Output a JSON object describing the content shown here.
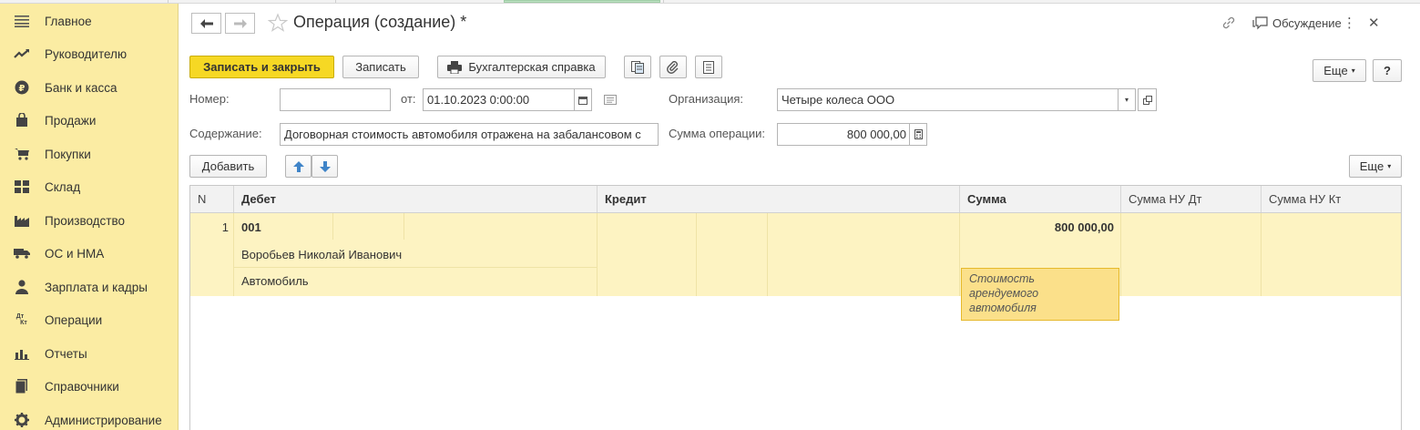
{
  "sidebar": {
    "items": [
      {
        "label": "Главное",
        "icon": "menu-lines-icon"
      },
      {
        "label": "Руководителю",
        "icon": "trend-icon"
      },
      {
        "label": "Банк и касса",
        "icon": "ruble-coin-icon"
      },
      {
        "label": "Продажи",
        "icon": "shopping-bag-icon"
      },
      {
        "label": "Покупки",
        "icon": "cart-icon"
      },
      {
        "label": "Склад",
        "icon": "warehouse-icon"
      },
      {
        "label": "Производство",
        "icon": "factory-icon"
      },
      {
        "label": "ОС и НМА",
        "icon": "truck-icon"
      },
      {
        "label": "Зарплата и кадры",
        "icon": "person-icon"
      },
      {
        "label": "Операции",
        "icon": "dt-kt-icon"
      },
      {
        "label": "Отчеты",
        "icon": "bar-chart-icon"
      },
      {
        "label": "Справочники",
        "icon": "book-icon"
      },
      {
        "label": "Администрирование",
        "icon": "gear-icon"
      }
    ],
    "dt_kt_top": "Дт",
    "dt_kt_bottom": "Кт"
  },
  "header": {
    "title": "Операция (создание) *",
    "discussion_label": "Обсуждение",
    "more_glyph": "⋮",
    "close_glyph": "✕"
  },
  "toolbar": {
    "save_close_label": "Записать и закрыть",
    "save_label": "Записать",
    "report_label": "Бухгалтерская справка",
    "more_label": "Еще",
    "help_label": "?"
  },
  "form": {
    "number_label": "Номер:",
    "number_value": "",
    "from_label": "от:",
    "date_value": "01.10.2023  0:00:00",
    "org_label": "Организация:",
    "org_value": "Четыре колеса ООО",
    "content_label": "Содержание:",
    "content_value": "Договорная стоимость автомобиля отражена на забалансовом с",
    "sum_label": "Сумма операции:",
    "sum_value": "800 000,00"
  },
  "table_toolbar": {
    "add_label": "Добавить",
    "more_label": "Еще"
  },
  "table": {
    "columns": [
      "N",
      "Дебет",
      "Кредит",
      "Сумма",
      "Сумма НУ Дт",
      "Сумма НУ Кт"
    ],
    "rows": [
      {
        "n": "1",
        "debit_account": "001",
        "debit_subconto1": "Воробьев Николай Иванович",
        "debit_subconto2": "Автомобиль",
        "sum": "800 000,00",
        "content": "Стоимость\nарендуемого\nавтомобиля"
      }
    ]
  },
  "colors": {
    "sidebar_bg": "#fbeca3",
    "primary_button": "#f6d824",
    "selected_row": "#fdf3c2",
    "note_bg": "#fbe08a"
  }
}
